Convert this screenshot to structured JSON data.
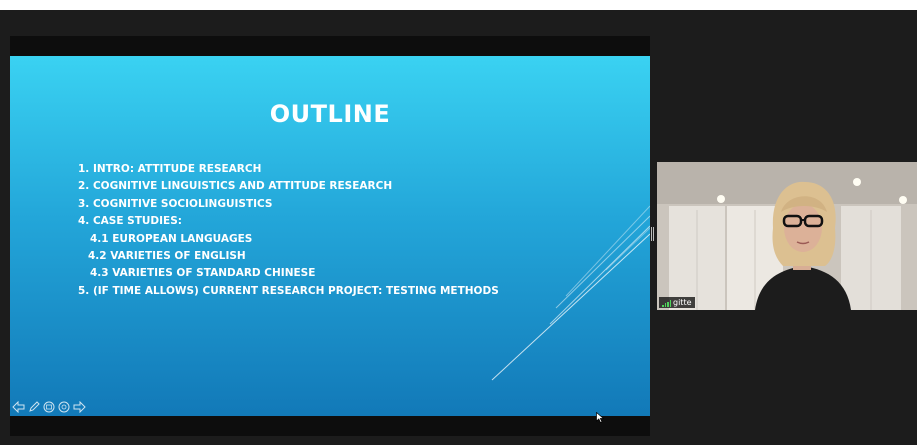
{
  "slide": {
    "title": "OUTLINE",
    "items": [
      "1. INTRO: ATTITUDE RESEARCH",
      "2. COGNITIVE LINGUISTICS AND ATTITUDE RESEARCH",
      "3. COGNITIVE SOCIOLINGUISTICS",
      "4.  CASE STUDIES:",
      "4.1 EUROPEAN LANGUAGES",
      "4.2 VARIETIES OF ENGLISH",
      "4.3 VARIETIES OF STANDARD CHINESE",
      "5. (IF TIME ALLOWS) CURRENT RESEARCH PROJECT: TESTING METHODS"
    ],
    "nav_icons": [
      "prev-arrow-icon",
      "pen-icon",
      "slides-icon",
      "zoom-icon",
      "next-arrow-icon"
    ]
  },
  "participant": {
    "name": "gitte",
    "icon": "signal-bars-icon"
  },
  "colors": {
    "app_background": "#1c1c1c",
    "slide_gradient_top": "#3ad2f2",
    "slide_gradient_bottom": "#1279b8",
    "signal_green": "#4fd25a"
  }
}
